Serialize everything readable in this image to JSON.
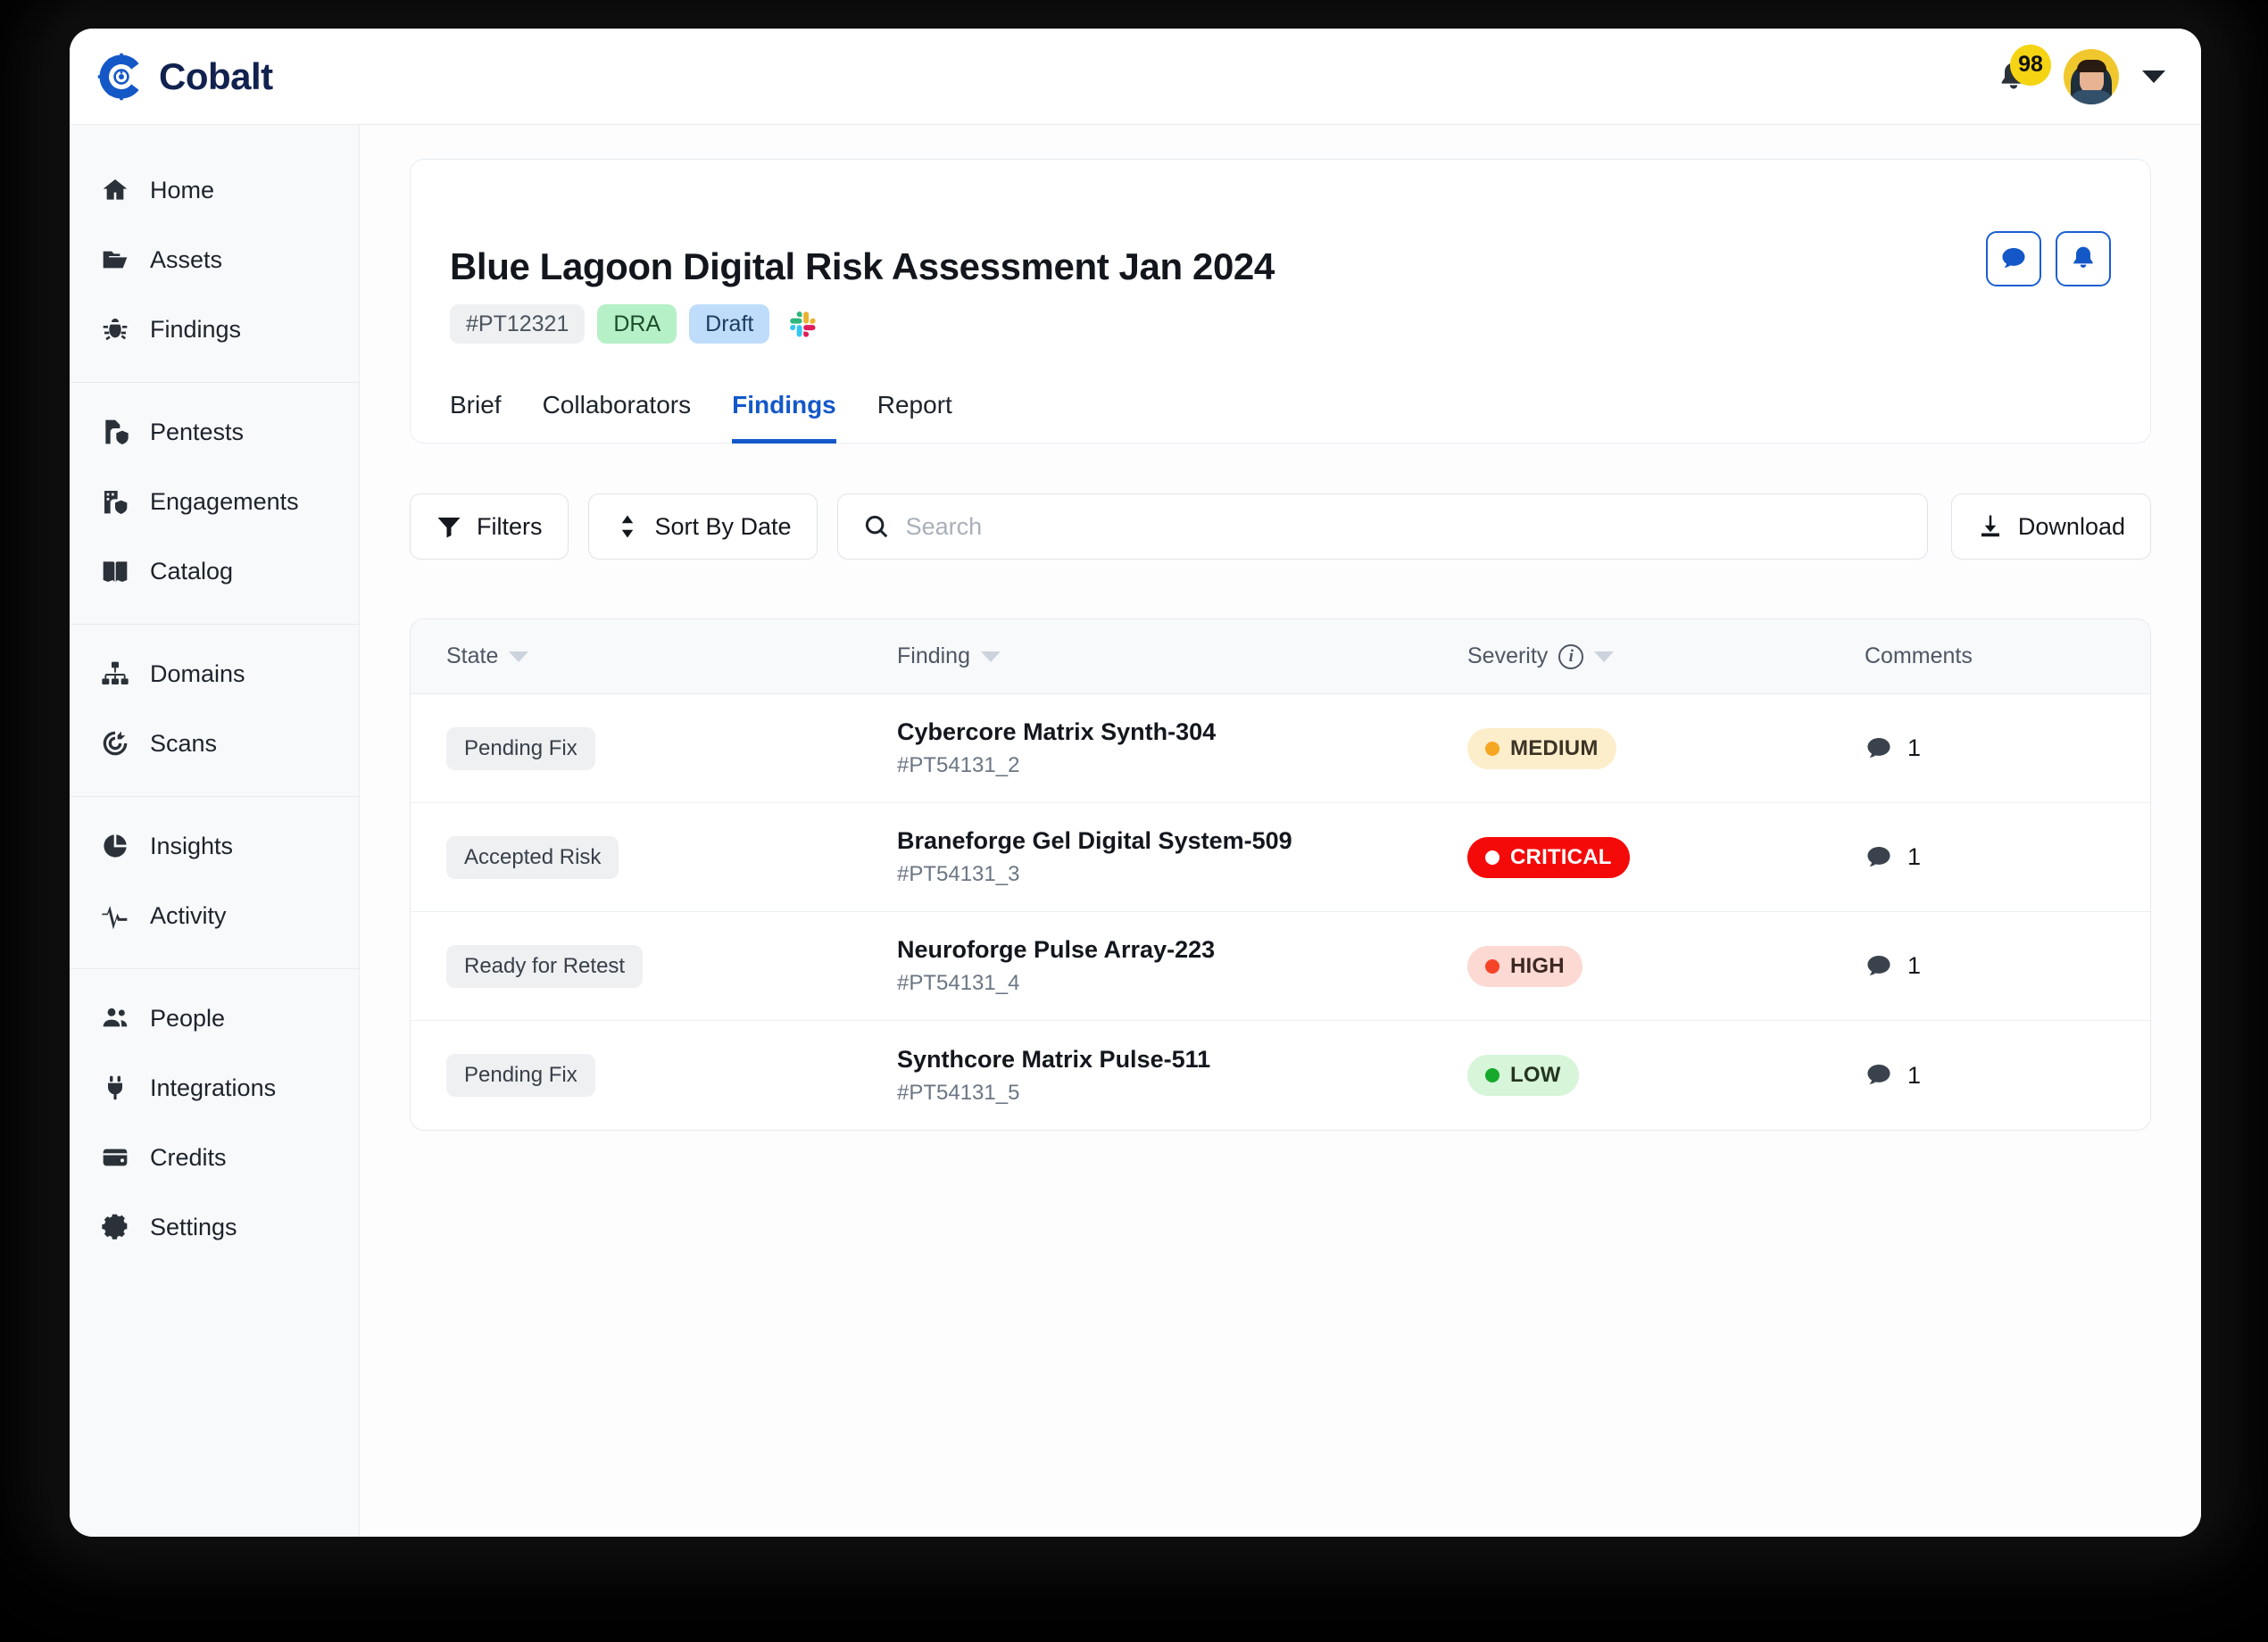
{
  "brand": {
    "name": "Cobalt",
    "logo_icon": "cobalt-gear-logo",
    "color": "#1458c8",
    "text_color": "#11224f"
  },
  "topbar": {
    "notification_icon": "bell-icon",
    "notification_count": "98",
    "badge_color": "#f5d413",
    "avatar_icon": "user-avatar",
    "account_menu_icon": "caret-down-icon"
  },
  "sidebar": {
    "groups": [
      {
        "items": [
          {
            "label": "Home",
            "icon": "home-icon"
          },
          {
            "label": "Assets",
            "icon": "folder-icon"
          },
          {
            "label": "Findings",
            "icon": "bug-icon"
          }
        ]
      },
      {
        "items": [
          {
            "label": "Pentests",
            "icon": "document-shield-icon"
          },
          {
            "label": "Engagements",
            "icon": "building-shield-icon"
          },
          {
            "label": "Catalog",
            "icon": "book-icon"
          }
        ]
      },
      {
        "items": [
          {
            "label": "Domains",
            "icon": "sitemap-icon"
          },
          {
            "label": "Scans",
            "icon": "target-icon"
          }
        ]
      },
      {
        "items": [
          {
            "label": "Insights",
            "icon": "pie-chart-icon"
          },
          {
            "label": "Activity",
            "icon": "pulse-icon"
          }
        ]
      },
      {
        "items": [
          {
            "label": "People",
            "icon": "people-icon"
          },
          {
            "label": "Integrations",
            "icon": "plug-icon"
          },
          {
            "label": "Credits",
            "icon": "wallet-icon"
          },
          {
            "label": "Settings",
            "icon": "gear-icon"
          }
        ]
      }
    ]
  },
  "header": {
    "title": "Blue Lagoon Digital Risk Assessment Jan 2024",
    "chips": {
      "id": "#PT12321",
      "type": "DRA",
      "status": "Draft",
      "integration_icon": "slack-icon"
    },
    "actions": [
      {
        "icon": "comment-icon",
        "name": "comment-button"
      },
      {
        "icon": "bell-icon",
        "name": "notifications-button"
      }
    ],
    "tabs": [
      {
        "label": "Brief",
        "active": false
      },
      {
        "label": "Collaborators",
        "active": false
      },
      {
        "label": "Findings",
        "active": true
      },
      {
        "label": "Report",
        "active": false
      }
    ],
    "active_tab_color": "#1458c8"
  },
  "toolbar": {
    "filters_label": "Filters",
    "filters_icon": "funnel-icon",
    "sort_label": "Sort By Date",
    "sort_icon": "sort-arrows-icon",
    "search_placeholder": "Search",
    "search_value": "",
    "search_icon": "search-icon",
    "download_label": "Download",
    "download_icon": "download-icon"
  },
  "table": {
    "columns": [
      {
        "label": "State",
        "sortable": true,
        "info": false
      },
      {
        "label": "Finding",
        "sortable": true,
        "info": false
      },
      {
        "label": "Severity",
        "sortable": true,
        "info": true
      },
      {
        "label": "Comments",
        "sortable": false,
        "info": false
      }
    ],
    "rows": [
      {
        "state": "Pending Fix",
        "finding_name": "Cybercore Matrix Synth-304",
        "finding_id": "#PT54131_2",
        "severity": "MEDIUM",
        "severity_bg": "#fdeecb",
        "severity_fg": "#3b3326",
        "severity_dot": "#f5a623",
        "comments": "1",
        "comments_icon": "comment-icon"
      },
      {
        "state": "Accepted Risk",
        "finding_name": "Braneforge Gel Digital System-509",
        "finding_id": "#PT54131_3",
        "severity": "CRITICAL",
        "severity_bg": "#f50a0a",
        "severity_fg": "#ffffff",
        "severity_dot": "#ffffff",
        "comments": "1",
        "comments_icon": "comment-icon"
      },
      {
        "state": "Ready for Retest",
        "finding_name": "Neuroforge Pulse Array-223",
        "finding_id": "#PT54131_4",
        "severity": "HIGH",
        "severity_bg": "#fcd9d2",
        "severity_fg": "#3b2723",
        "severity_dot": "#f5442a",
        "comments": "1",
        "comments_icon": "comment-icon"
      },
      {
        "state": "Pending Fix",
        "finding_name": "Synthcore Matrix Pulse-511",
        "finding_id": "#PT54131_5",
        "severity": "LOW",
        "severity_bg": "#d6f5d9",
        "severity_fg": "#24331f",
        "severity_dot": "#17a92b",
        "comments": "1",
        "comments_icon": "comment-icon"
      }
    ]
  }
}
